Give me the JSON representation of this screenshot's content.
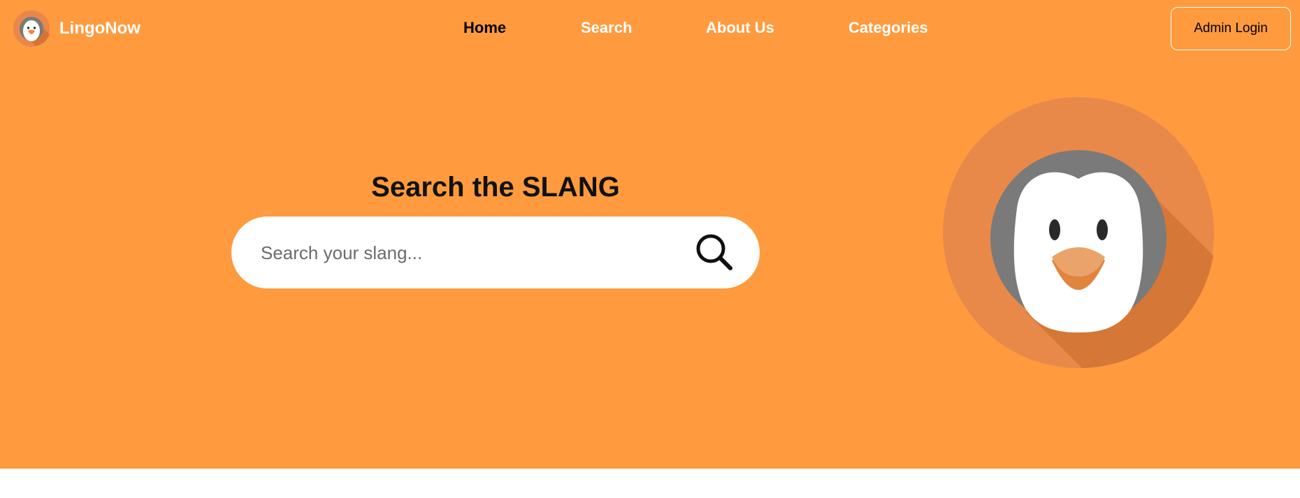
{
  "brand": {
    "name": "LingoNow",
    "logo_icon": "penguin-logo-icon"
  },
  "nav": {
    "items": [
      {
        "label": "Home",
        "active": true
      },
      {
        "label": "Search",
        "active": false
      },
      {
        "label": "About Us",
        "active": false
      },
      {
        "label": "Categories",
        "active": false
      }
    ]
  },
  "header": {
    "admin_login_label": "Admin Login"
  },
  "hero": {
    "title": "Search the SLANG",
    "search": {
      "placeholder": "Search your slang...",
      "value": "",
      "icon": "search-icon"
    },
    "mascot_icon": "penguin-illustration"
  },
  "colors": {
    "hero_background": "#ff9b3e",
    "page_background": "#ffffff",
    "nav_text": "#ffffff",
    "nav_active_text": "#000000"
  }
}
